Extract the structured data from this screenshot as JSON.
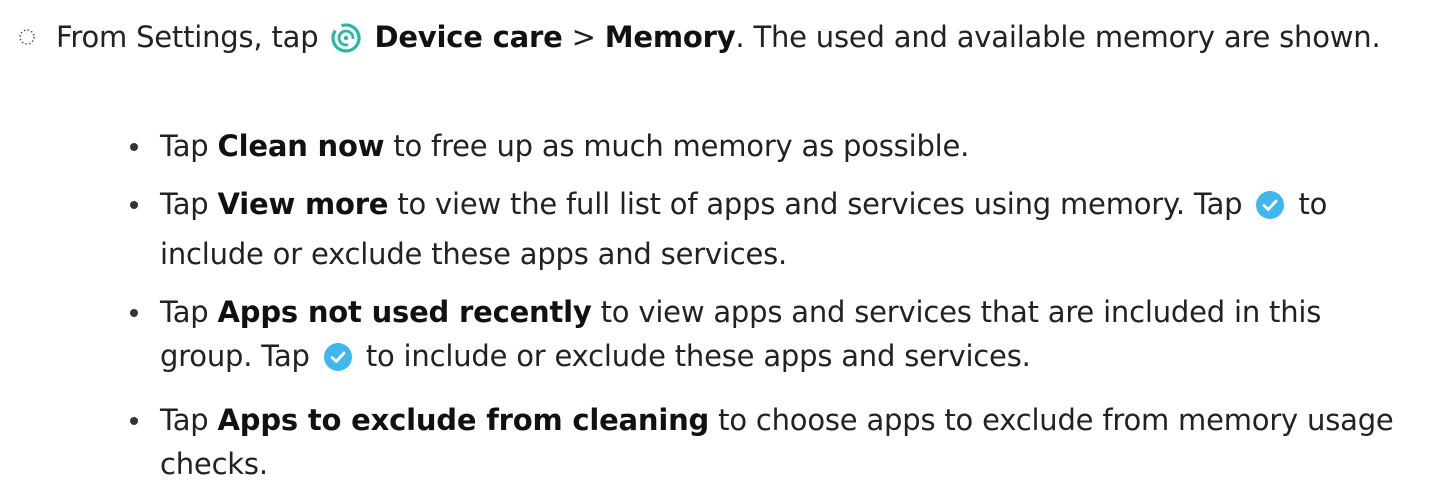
{
  "step": {
    "prefix": "From Settings, tap",
    "device_care_label": "Device care",
    "separator": ">",
    "memory_label": "Memory",
    "suffix": ". The used and available memory are shown."
  },
  "bullets": [
    {
      "tap": "Tap",
      "label": "Clean now",
      "text": "to free up as much memory as possible."
    },
    {
      "tap": "Tap",
      "label": "View more",
      "text": "to view the full list of apps and services using memory. Tap",
      "after_icon": "to include or exclude these apps and services."
    },
    {
      "tap": "Tap",
      "label": "Apps not used recently",
      "text": "to view apps and services that are included in this group. Tap",
      "after_icon": "to include or exclude these apps and services."
    },
    {
      "tap": "Tap",
      "label": "Apps to exclude from cleaning",
      "text": "to choose apps to exclude from memory usage checks."
    }
  ],
  "icons": {
    "step_marker": "dotted-circle-icon",
    "device_care": "device-care-icon",
    "checkmark": "checkmark-circle-icon"
  },
  "colors": {
    "device_care_icon": "#2bb5a3",
    "checkmark_icon": "#3fb6ec"
  }
}
